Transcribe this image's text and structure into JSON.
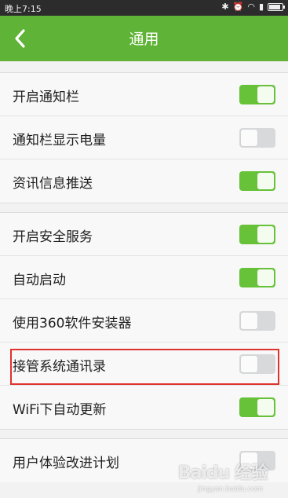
{
  "status_bar": {
    "time": "晚上7:15"
  },
  "header": {
    "title": "通用"
  },
  "groups": [
    {
      "items": [
        {
          "label": "开启通知栏",
          "on": true
        },
        {
          "label": "通知栏显示电量",
          "on": false
        },
        {
          "label": "资讯信息推送",
          "on": true
        }
      ]
    },
    {
      "items": [
        {
          "label": "开启安全服务",
          "on": true
        },
        {
          "label": "自动启动",
          "on": true
        },
        {
          "label": "使用360软件安装器",
          "on": false
        },
        {
          "label": "接管系统通讯录",
          "on": false
        },
        {
          "label": "WiFi下自动更新",
          "on": true
        }
      ]
    },
    {
      "items": [
        {
          "label": "用户体验改进计划",
          "on": false
        }
      ]
    }
  ],
  "watermark": {
    "text": "Baidu 经验",
    "subtext": "jingyan.baidu.com"
  },
  "colors": {
    "accent": "#5fb336",
    "toggle_on": "#67c23a",
    "toggle_off": "#d7d9db",
    "highlight": "#e0322d"
  }
}
